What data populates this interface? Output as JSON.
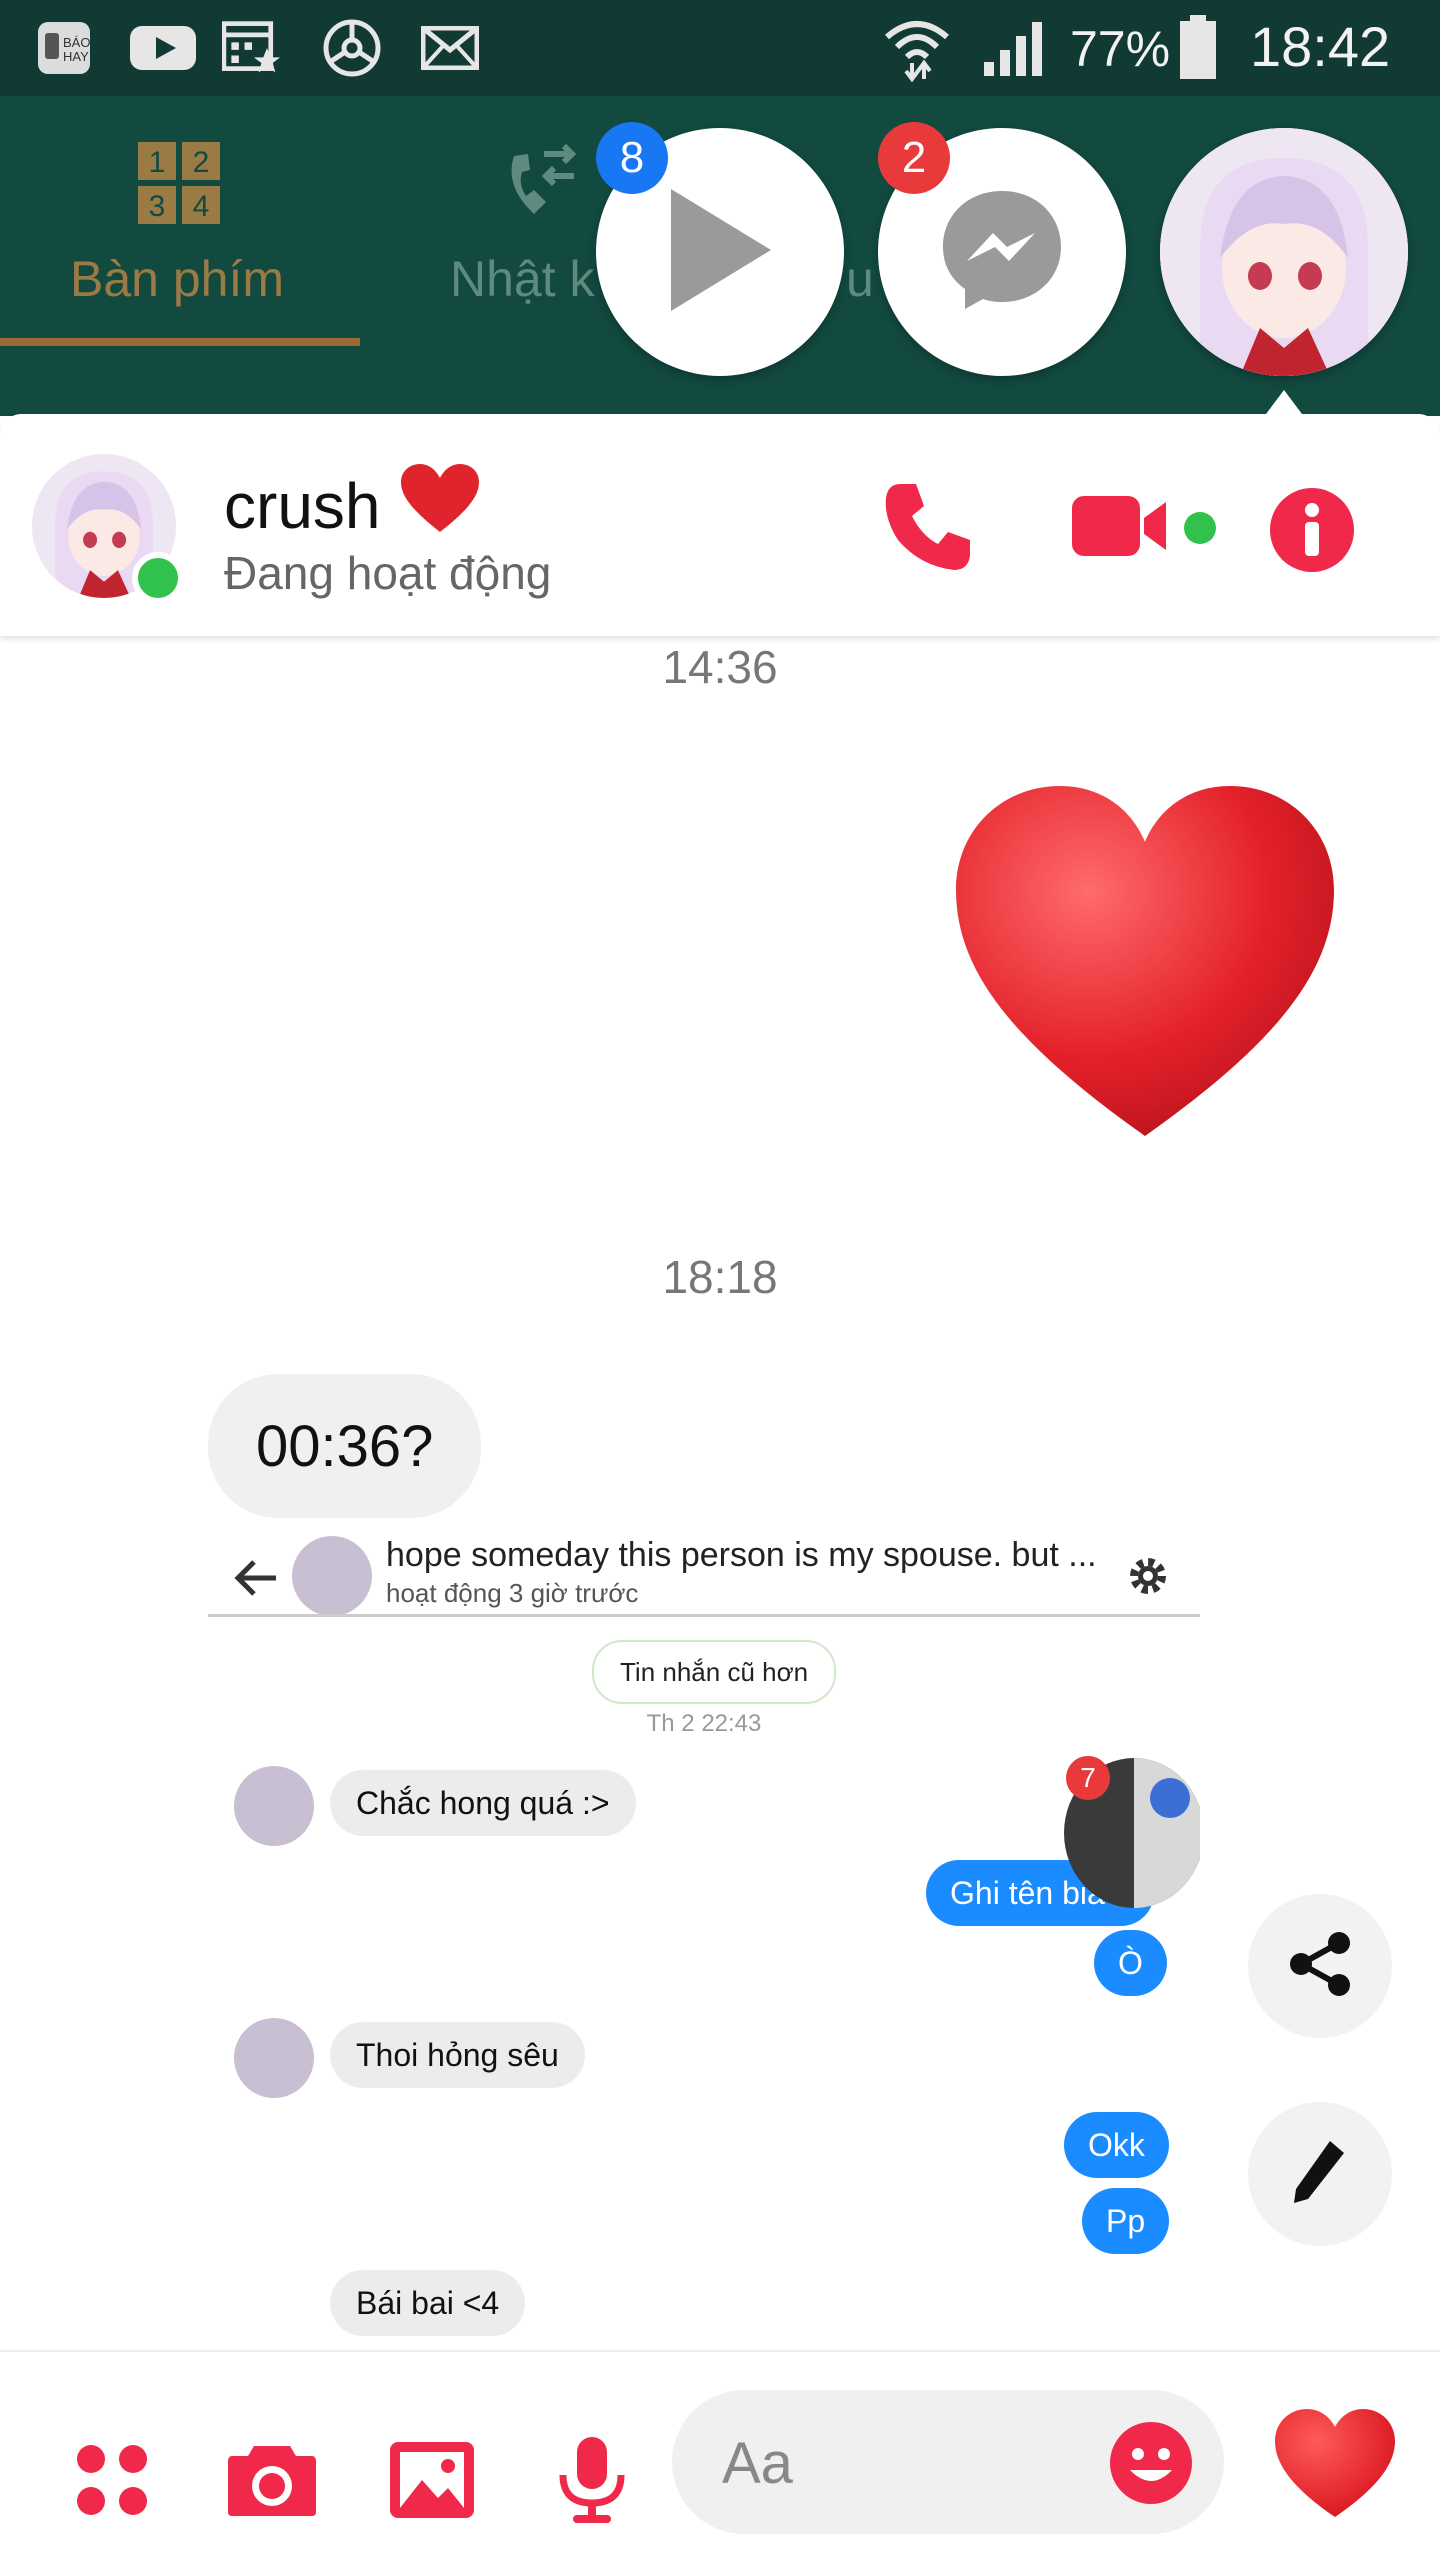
{
  "status_bar": {
    "icons": [
      "bao-hay-app-icon",
      "youtube-icon",
      "calendar-icon",
      "steering-wheel-icon",
      "mail-icon",
      "wifi-icon",
      "signal-icon",
      "battery-icon"
    ],
    "battery": "77%",
    "time": "18:42"
  },
  "dialer": {
    "tabs": [
      {
        "label": "Bàn phím",
        "icon": "keypad-icon"
      },
      {
        "label": "Nhật k",
        "icon": "call-log-icon"
      },
      {
        "label": "u",
        "icon": "favorites-icon"
      }
    ]
  },
  "chat_heads": [
    {
      "name": "video-player",
      "icon": "play-icon",
      "badge": "8",
      "badge_color": "#1877f2"
    },
    {
      "name": "messenger",
      "icon": "messenger-icon",
      "badge": "2",
      "badge_color": "#e83a3a"
    },
    {
      "name": "crush-avatar",
      "icon": "anime-avatar"
    }
  ],
  "chat": {
    "contact_name": "crush",
    "contact_emoji": "❤️",
    "status": "Đang hoạt động",
    "accent": "#f02849",
    "online_color": "#31c24d",
    "messages": [
      {
        "type": "timestamp",
        "text": "14:36"
      },
      {
        "type": "outgoing-heart"
      },
      {
        "type": "timestamp",
        "text": "18:18"
      },
      {
        "type": "incoming",
        "text": "00:36?"
      }
    ]
  },
  "screenshot": {
    "title": "hope someday this person is my spouse. but ...",
    "subtitle": "hoạt động 3 giờ trước",
    "older_button": "Tin nhắn cũ hơn",
    "timestamp": "Th 2 22:43",
    "chathead_badge": "7",
    "messages": [
      {
        "side": "in",
        "text": "Chắc hong quá :>"
      },
      {
        "side": "out",
        "text": "Ghi tên bia"
      },
      {
        "side": "out",
        "text": "Ò"
      },
      {
        "side": "in",
        "text": "Thoi hỏng sêu"
      },
      {
        "side": "out",
        "text": "Okk"
      },
      {
        "side": "out",
        "text": "Pp"
      },
      {
        "side": "in",
        "text": "Bái bai <4"
      }
    ]
  },
  "composer": {
    "placeholder": "Aa",
    "icons": [
      "more-apps-icon",
      "camera-icon",
      "gallery-icon",
      "microphone-icon",
      "emoji-icon",
      "heart-like-icon"
    ]
  }
}
